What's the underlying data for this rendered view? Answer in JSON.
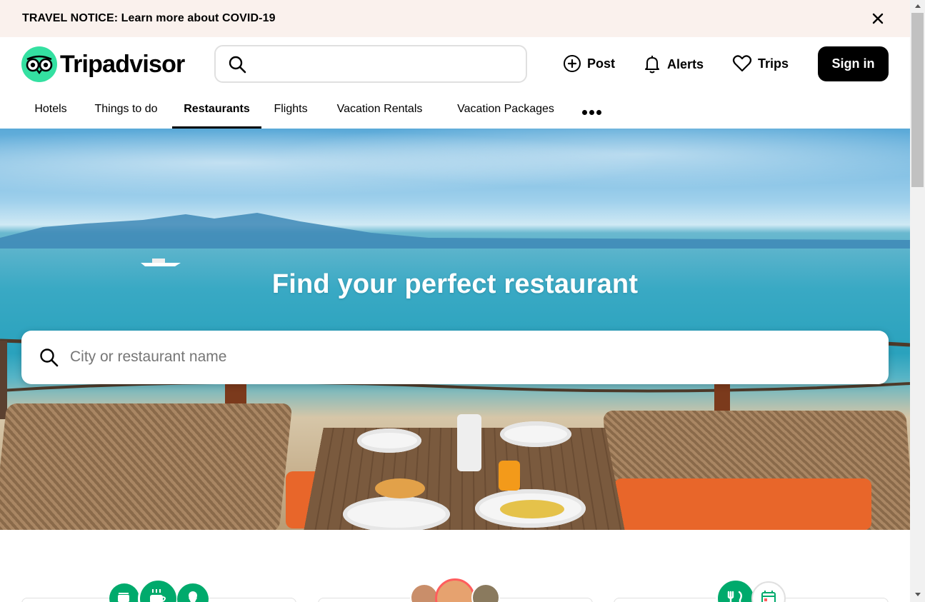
{
  "notice": {
    "text": "TRAVEL NOTICE: Learn more about COVID-19",
    "close_icon": "close-icon"
  },
  "header": {
    "logo_text": "Tripadvisor",
    "search_placeholder": "",
    "actions": [
      {
        "label": "Post",
        "icon": "plus-circle-icon"
      },
      {
        "label": "Alerts",
        "icon": "bell-icon"
      },
      {
        "label": "Trips",
        "icon": "heart-icon"
      }
    ],
    "signin_label": "Sign in"
  },
  "tabs": [
    {
      "label": "Hotels",
      "active": false
    },
    {
      "label": "Things to do",
      "active": false
    },
    {
      "label": "Restaurants",
      "active": true
    },
    {
      "label": "Flights",
      "active": false
    },
    {
      "label": "Vacation Rentals",
      "active": false
    },
    {
      "label": "Vacation Packages",
      "active": false
    }
  ],
  "more_icon": "more-dots-icon",
  "hero": {
    "title": "Find your perfect restaurant",
    "search_placeholder": "City or restaurant name"
  },
  "colors": {
    "brand_green": "#34e0a1",
    "accent_teal": "#00aa6c",
    "notice_bg": "#faf1ed"
  }
}
